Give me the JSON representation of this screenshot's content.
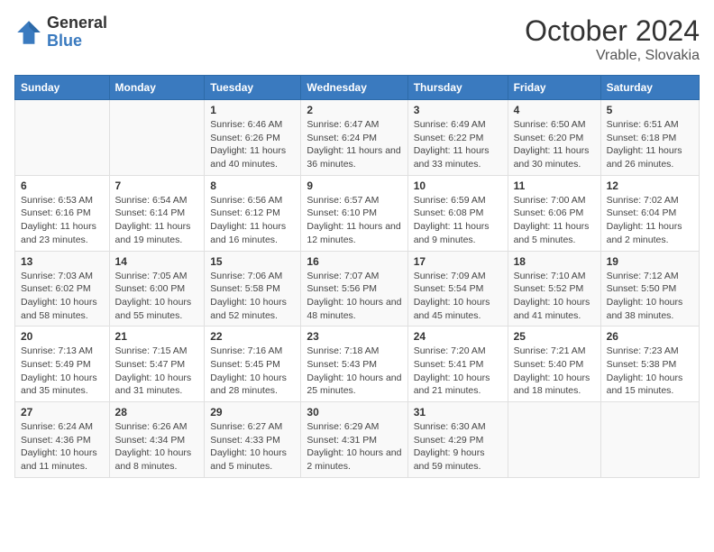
{
  "header": {
    "logo_line1": "General",
    "logo_line2": "Blue",
    "title": "October 2024",
    "subtitle": "Vrable, Slovakia"
  },
  "calendar": {
    "days_of_week": [
      "Sunday",
      "Monday",
      "Tuesday",
      "Wednesday",
      "Thursday",
      "Friday",
      "Saturday"
    ],
    "weeks": [
      [
        {
          "day": "",
          "text": ""
        },
        {
          "day": "",
          "text": ""
        },
        {
          "day": "1",
          "text": "Sunrise: 6:46 AM\nSunset: 6:26 PM\nDaylight: 11 hours and 40 minutes."
        },
        {
          "day": "2",
          "text": "Sunrise: 6:47 AM\nSunset: 6:24 PM\nDaylight: 11 hours and 36 minutes."
        },
        {
          "day": "3",
          "text": "Sunrise: 6:49 AM\nSunset: 6:22 PM\nDaylight: 11 hours and 33 minutes."
        },
        {
          "day": "4",
          "text": "Sunrise: 6:50 AM\nSunset: 6:20 PM\nDaylight: 11 hours and 30 minutes."
        },
        {
          "day": "5",
          "text": "Sunrise: 6:51 AM\nSunset: 6:18 PM\nDaylight: 11 hours and 26 minutes."
        }
      ],
      [
        {
          "day": "6",
          "text": "Sunrise: 6:53 AM\nSunset: 6:16 PM\nDaylight: 11 hours and 23 minutes."
        },
        {
          "day": "7",
          "text": "Sunrise: 6:54 AM\nSunset: 6:14 PM\nDaylight: 11 hours and 19 minutes."
        },
        {
          "day": "8",
          "text": "Sunrise: 6:56 AM\nSunset: 6:12 PM\nDaylight: 11 hours and 16 minutes."
        },
        {
          "day": "9",
          "text": "Sunrise: 6:57 AM\nSunset: 6:10 PM\nDaylight: 11 hours and 12 minutes."
        },
        {
          "day": "10",
          "text": "Sunrise: 6:59 AM\nSunset: 6:08 PM\nDaylight: 11 hours and 9 minutes."
        },
        {
          "day": "11",
          "text": "Sunrise: 7:00 AM\nSunset: 6:06 PM\nDaylight: 11 hours and 5 minutes."
        },
        {
          "day": "12",
          "text": "Sunrise: 7:02 AM\nSunset: 6:04 PM\nDaylight: 11 hours and 2 minutes."
        }
      ],
      [
        {
          "day": "13",
          "text": "Sunrise: 7:03 AM\nSunset: 6:02 PM\nDaylight: 10 hours and 58 minutes."
        },
        {
          "day": "14",
          "text": "Sunrise: 7:05 AM\nSunset: 6:00 PM\nDaylight: 10 hours and 55 minutes."
        },
        {
          "day": "15",
          "text": "Sunrise: 7:06 AM\nSunset: 5:58 PM\nDaylight: 10 hours and 52 minutes."
        },
        {
          "day": "16",
          "text": "Sunrise: 7:07 AM\nSunset: 5:56 PM\nDaylight: 10 hours and 48 minutes."
        },
        {
          "day": "17",
          "text": "Sunrise: 7:09 AM\nSunset: 5:54 PM\nDaylight: 10 hours and 45 minutes."
        },
        {
          "day": "18",
          "text": "Sunrise: 7:10 AM\nSunset: 5:52 PM\nDaylight: 10 hours and 41 minutes."
        },
        {
          "day": "19",
          "text": "Sunrise: 7:12 AM\nSunset: 5:50 PM\nDaylight: 10 hours and 38 minutes."
        }
      ],
      [
        {
          "day": "20",
          "text": "Sunrise: 7:13 AM\nSunset: 5:49 PM\nDaylight: 10 hours and 35 minutes."
        },
        {
          "day": "21",
          "text": "Sunrise: 7:15 AM\nSunset: 5:47 PM\nDaylight: 10 hours and 31 minutes."
        },
        {
          "day": "22",
          "text": "Sunrise: 7:16 AM\nSunset: 5:45 PM\nDaylight: 10 hours and 28 minutes."
        },
        {
          "day": "23",
          "text": "Sunrise: 7:18 AM\nSunset: 5:43 PM\nDaylight: 10 hours and 25 minutes."
        },
        {
          "day": "24",
          "text": "Sunrise: 7:20 AM\nSunset: 5:41 PM\nDaylight: 10 hours and 21 minutes."
        },
        {
          "day": "25",
          "text": "Sunrise: 7:21 AM\nSunset: 5:40 PM\nDaylight: 10 hours and 18 minutes."
        },
        {
          "day": "26",
          "text": "Sunrise: 7:23 AM\nSunset: 5:38 PM\nDaylight: 10 hours and 15 minutes."
        }
      ],
      [
        {
          "day": "27",
          "text": "Sunrise: 6:24 AM\nSunset: 4:36 PM\nDaylight: 10 hours and 11 minutes."
        },
        {
          "day": "28",
          "text": "Sunrise: 6:26 AM\nSunset: 4:34 PM\nDaylight: 10 hours and 8 minutes."
        },
        {
          "day": "29",
          "text": "Sunrise: 6:27 AM\nSunset: 4:33 PM\nDaylight: 10 hours and 5 minutes."
        },
        {
          "day": "30",
          "text": "Sunrise: 6:29 AM\nSunset: 4:31 PM\nDaylight: 10 hours and 2 minutes."
        },
        {
          "day": "31",
          "text": "Sunrise: 6:30 AM\nSunset: 4:29 PM\nDaylight: 9 hours and 59 minutes."
        },
        {
          "day": "",
          "text": ""
        },
        {
          "day": "",
          "text": ""
        }
      ]
    ]
  }
}
